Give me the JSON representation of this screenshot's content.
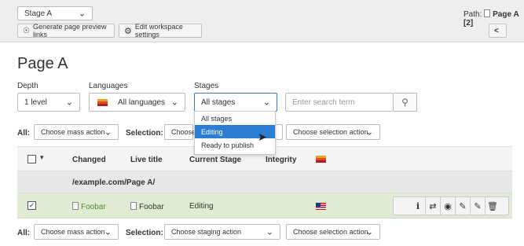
{
  "topbar": {
    "stage_select": "Stage A",
    "path_label": "Path:",
    "path_value": "Page A [2]",
    "preview_button": "Generate page preview links",
    "settings_button": "Edit workspace settings"
  },
  "page_title": "Page A",
  "filters": {
    "depth_label": "Depth",
    "depth_value": "1 level",
    "languages_label": "Languages",
    "languages_value": "All languages",
    "stages_label": "Stages",
    "stages_value": "All stages",
    "search_placeholder": "Enter search term"
  },
  "stages_dropdown": {
    "options": [
      "All stages",
      "Editing",
      "Ready to publish"
    ],
    "highlighted": "Editing"
  },
  "mass_action_top": {
    "all_label": "All:",
    "mass_action": "Choose mass action",
    "selection_label": "Selection:",
    "staging_action": "Choose",
    "selection_action": "Choose selection action"
  },
  "table": {
    "headers": {
      "changed": "Changed",
      "live_title": "Live title",
      "current_stage": "Current Stage",
      "integrity": "Integrity"
    },
    "group_path": "/example.com/Page A/",
    "rows": [
      {
        "changed": "Foobar",
        "live_title": "Foobar",
        "current_stage": "Editing"
      }
    ]
  },
  "mass_action_bottom": {
    "all_label": "All:",
    "mass_action": "Choose mass action",
    "selection_label": "Selection:",
    "staging_action": "Choose staging action",
    "selection_action": "Choose selection action"
  },
  "colors": {
    "highlight": "#2b7cd3",
    "row_green": "#dfecd3",
    "link_green": "#4d8c2e"
  }
}
